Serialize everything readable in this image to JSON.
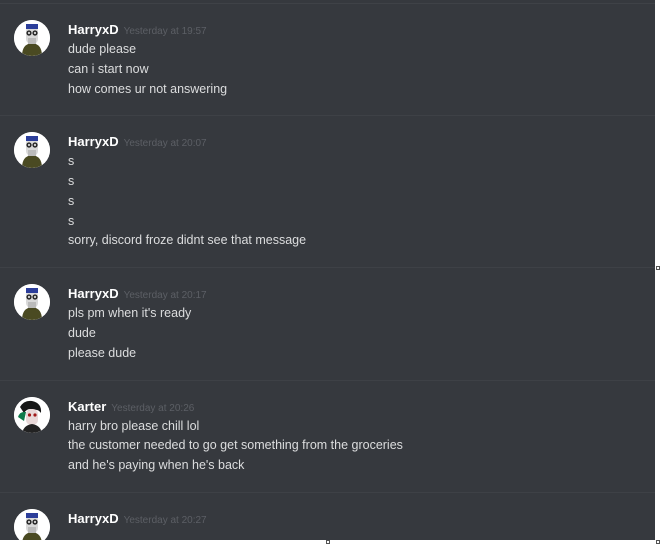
{
  "messages": [
    {
      "author": "HarryxD",
      "timestamp": "Yesterday at 19:57",
      "lines": [
        "dude please",
        "can i start now",
        "how comes ur not answering"
      ]
    },
    {
      "author": "HarryxD",
      "timestamp": "Yesterday at 20:07",
      "lines": [
        "s",
        "s",
        "s",
        "s",
        "sorry, discord froze didnt see that message"
      ]
    },
    {
      "author": "HarryxD",
      "timestamp": "Yesterday at 20:17",
      "lines": [
        "pls pm when it's ready",
        "dude",
        "please dude"
      ]
    },
    {
      "author": "Karter",
      "timestamp": "Yesterday at 20:26",
      "lines": [
        "harry bro please chill lol",
        "the customer needed to go get something from the groceries",
        "and he's paying when he's back"
      ]
    },
    {
      "author": "HarryxD",
      "timestamp": "Yesterday at 20:27",
      "lines": []
    }
  ],
  "colors": {
    "background": "#36393e",
    "username": "#ffffff",
    "timestamp": "#5c5f65",
    "message_text": "#dcddde"
  }
}
